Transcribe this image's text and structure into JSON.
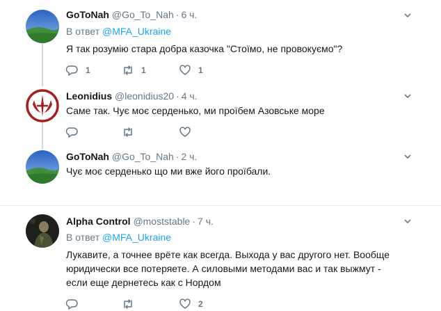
{
  "tweets": [
    {
      "name": "GoToNah",
      "handle": "@Go_To_Nah",
      "time": "6 ч.",
      "reply_prefix": "В ответ",
      "reply_to": "@MFA_Ukraine",
      "text": "Я так розумію стара добра казочка \"Стоїмо, не провокуємо\"?",
      "replies": "1",
      "retweets": "1",
      "likes": "1"
    },
    {
      "name": "Leonidius",
      "handle": "@leonidius20",
      "time": "4 ч.",
      "text": "Саме так. Чує моє серденько, ми проїбем Азовське море"
    },
    {
      "name": "GoToNah",
      "handle": "@Go_To_Nah",
      "time": "2 ч.",
      "text": "Чує моє серденько що ми вже його проїбали."
    },
    {
      "name": "Alpha Control",
      "handle": "@moststable",
      "time": "7 ч.",
      "reply_prefix": "В ответ",
      "reply_to": "@MFA_Ukraine",
      "text": "Лукавите, а точнее врёте как всегда. Выхода у вас другого нет. Вообще юридически все потеряете. А силовыми методами вас и так выжмут - если еще дернетесь как с Нордом",
      "replies": "",
      "retweets": "",
      "likes": "2"
    }
  ],
  "colors": {
    "link": "#1da1f2",
    "secondary": "#657786",
    "thread_line": "#cfd9de",
    "divider": "#e6ecf0"
  },
  "icons": {
    "reply": "reply-icon",
    "retweet": "retweet-icon",
    "like": "heart-icon",
    "menu": "chevron-down-icon"
  }
}
